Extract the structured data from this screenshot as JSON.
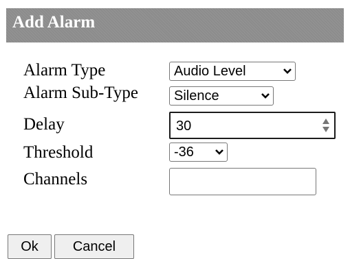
{
  "dialog": {
    "title": "Add Alarm"
  },
  "form": {
    "alarm_type": {
      "label": "Alarm Type",
      "selected": "Audio Level"
    },
    "alarm_sub_type": {
      "label": "Alarm Sub-Type",
      "selected": "Silence"
    },
    "delay": {
      "label": "Delay",
      "value": "30"
    },
    "threshold": {
      "label": "Threshold",
      "selected": "-36"
    },
    "channels": {
      "label": "Channels",
      "value": ""
    }
  },
  "buttons": {
    "ok_label": "Ok",
    "cancel_label": "Cancel"
  },
  "icons": {
    "dropdown": "chevron-down-icon",
    "spinner": "spinner-arrows-icon"
  }
}
